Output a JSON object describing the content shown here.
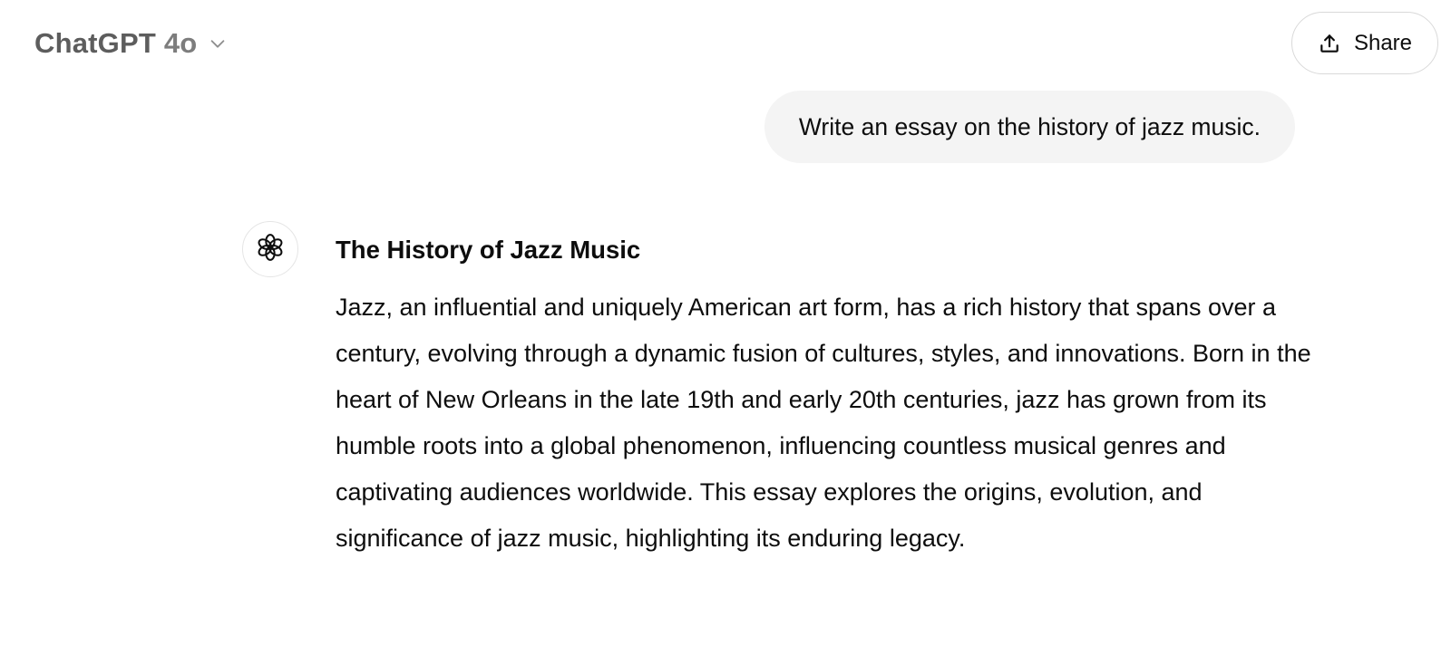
{
  "header": {
    "model_name": "ChatGPT",
    "model_version": "4o",
    "model_dropdown_icon": "chevron-down-icon",
    "share_label": "Share",
    "share_icon": "share-upload-icon"
  },
  "conversation": {
    "user_message": "Write an essay on the history of jazz music.",
    "assistant": {
      "avatar_icon": "openai-logo-icon",
      "title": "The History of Jazz Music",
      "paragraph": "Jazz, an influential and uniquely American art form, has a rich history that spans over a century, evolving through a dynamic fusion of cultures, styles, and innovations. Born in the heart of New Orleans in the late 19th and early 20th centuries, jazz has grown from its humble roots into a global phenomenon, influencing countless musical genres and captivating audiences worldwide. This essay explores the origins, evolution, and significance of jazz music, highlighting its enduring legacy."
    }
  },
  "colors": {
    "model_name": "#5d5d5d",
    "user_bubble_bg": "#f4f4f4",
    "text": "#0d0d0d",
    "border": "#d9d9d9"
  }
}
